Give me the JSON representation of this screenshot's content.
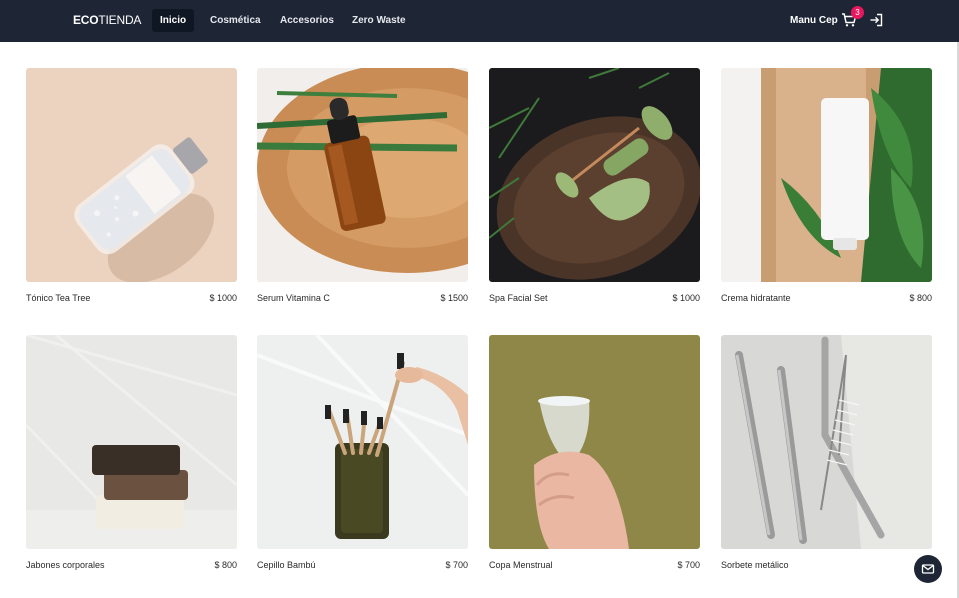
{
  "navbar": {
    "brand_bold": "ECO",
    "brand_rest": "TIENDA",
    "links": [
      "Inicio",
      "Cosmética",
      "Accesorios",
      "Zero Waste"
    ],
    "active": "Inicio",
    "user_name": "Manu Cep",
    "cart_count": "3"
  },
  "products": [
    {
      "name": "Tónico Tea Tree",
      "price": "$ 1000"
    },
    {
      "name": "Serum Vitamina C",
      "price": "$ 1500"
    },
    {
      "name": "Spa Facial Set",
      "price": "$ 1000"
    },
    {
      "name": "Crema hidratante",
      "price": "$ 800"
    },
    {
      "name": "Jabones corporales",
      "price": "$ 800"
    },
    {
      "name": "Cepillo Bambú",
      "price": "$ 700"
    },
    {
      "name": "Copa Menstrual",
      "price": "$ 700"
    },
    {
      "name": "Sorbete metálico",
      "price": "$"
    }
  ],
  "icons": {
    "cart": "shopping-cart-icon",
    "logout": "logout-icon",
    "mail": "mail-icon"
  },
  "colors": {
    "navbar_bg": "#1e2535",
    "badge": "#e8175d"
  }
}
